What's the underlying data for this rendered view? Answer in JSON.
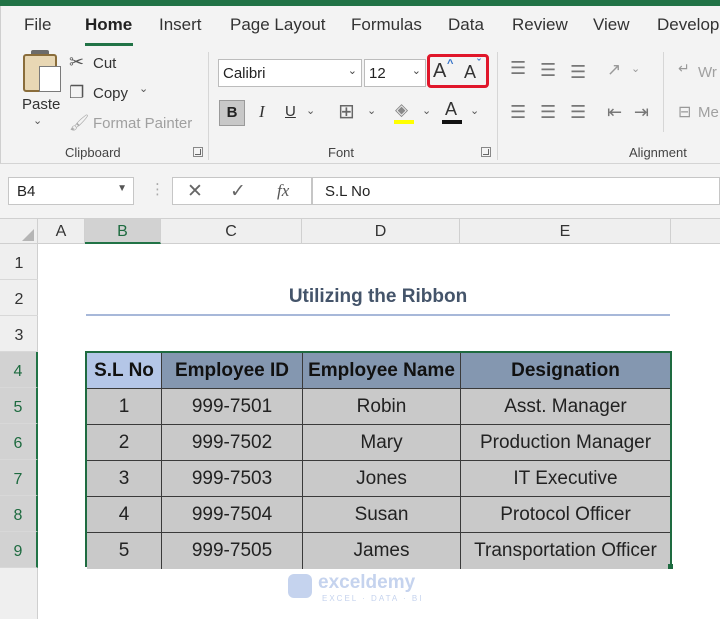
{
  "tabs": [
    "File",
    "Home",
    "Insert",
    "Page Layout",
    "Formulas",
    "Data",
    "Review",
    "View",
    "Develop"
  ],
  "active_tab": "Home",
  "ribbon": {
    "clipboard": {
      "paste_label": "Paste",
      "cut_label": "Cut",
      "copy_label": "Copy",
      "format_painter_label": "Format Painter",
      "group_label": "Clipboard"
    },
    "font": {
      "font_name": "Calibri",
      "font_size": "12",
      "increase_size_glyph": "A",
      "decrease_size_glyph": "A",
      "bold_label": "B",
      "italic_label": "I",
      "underline_label": "U",
      "font_color_glyph": "A",
      "group_label": "Font"
    },
    "alignment": {
      "wrap_label": "Wr",
      "merge_label": "Me",
      "group_label": "Alignment"
    }
  },
  "formula_bar": {
    "name_box": "B4",
    "fx_label": "fx",
    "content": "S.L No"
  },
  "sheet": {
    "columns": [
      "A",
      "B",
      "C",
      "D",
      "E"
    ],
    "rows": [
      "1",
      "2",
      "3",
      "4",
      "5",
      "6",
      "7",
      "8",
      "9"
    ],
    "title": "Utilizing the Ribbon",
    "headers": [
      "S.L No",
      "Employee ID",
      "Employee Name",
      "Designation"
    ],
    "data": [
      [
        "1",
        "999-7501",
        "Robin",
        "Asst. Manager"
      ],
      [
        "2",
        "999-7502",
        "Mary",
        "Production Manager"
      ],
      [
        "3",
        "999-7503",
        "Jones",
        "IT Executive"
      ],
      [
        "4",
        "999-7504",
        "Susan",
        "Protocol Officer"
      ],
      [
        "5",
        "999-7505",
        "James",
        "Transportation Officer"
      ]
    ]
  },
  "watermark": {
    "name": "exceldemy",
    "tagline": "EXCEL · DATA · BI"
  },
  "colors": {
    "accent": "#217346",
    "highlight": "#e0162a",
    "header_fill": "#8497b0",
    "body_fill": "#c9c9c9"
  }
}
